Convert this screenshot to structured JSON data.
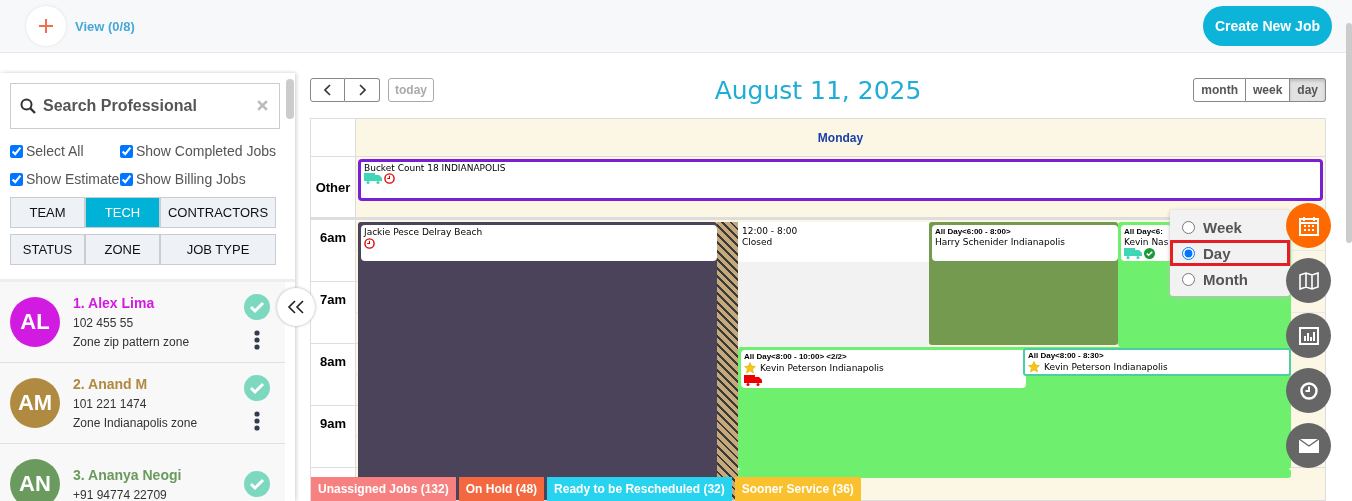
{
  "header": {
    "view_label": "View (0/8)",
    "create_button": "Create New Job"
  },
  "sidebar": {
    "search": {
      "placeholder": "Search Professional"
    },
    "options": [
      {
        "label": "Select All",
        "checked": true
      },
      {
        "label": "Show Completed Jobs",
        "checked": true
      },
      {
        "label": "Show Estimate",
        "checked": true
      },
      {
        "label": "Show Billing Jobs",
        "checked": true
      }
    ],
    "filter_tabs": [
      {
        "label": "TEAM",
        "selected": false
      },
      {
        "label": "TECH",
        "selected": true
      },
      {
        "label": "CONTRACTORS",
        "selected": false
      },
      {
        "label": "STATUS",
        "selected": false
      },
      {
        "label": "ZONE",
        "selected": false
      },
      {
        "label": "JOB TYPE",
        "selected": false
      }
    ],
    "technicians": [
      {
        "initials": "AL",
        "name": "1. Alex Lima",
        "phone": "102 455 55",
        "zone": "Zone zip pattern zone",
        "color": "#d21be0"
      },
      {
        "initials": "AM",
        "name": "2. Anand M",
        "phone": "101 221 1474",
        "zone": "Zone Indianapolis zone",
        "color": "#b08a40"
      },
      {
        "initials": "AN",
        "name": "3. Ananya Neogi",
        "phone": "+91 94774 22709",
        "color": "#6a9a5e"
      }
    ]
  },
  "calendar": {
    "today_button": "today",
    "title": "August 11, 2025",
    "views": [
      {
        "label": "month",
        "selected": false
      },
      {
        "label": "week",
        "selected": false
      },
      {
        "label": "day",
        "selected": true
      }
    ],
    "day_header": "Monday",
    "other_label": "Other",
    "other_event": {
      "title": "Bucket Count 18 INDIANAPOLIS",
      "color": "#7b1fd6"
    },
    "hours": [
      "6am",
      "7am",
      "8am",
      "9am"
    ],
    "events": [
      {
        "kind": "job",
        "title": "Jackie Pesce Delray Beach",
        "color": "#4a4359"
      },
      {
        "kind": "unavailable"
      },
      {
        "kind": "closed",
        "time": "12:00 - 8:00",
        "title": "Closed"
      },
      {
        "kind": "job",
        "time": "All Day<6:00 - 8:00>",
        "title": "Harry Schenider Indianapolis",
        "color": "#739a4e"
      },
      {
        "kind": "job",
        "time": "All Day<6:",
        "title": "Kevin Nas",
        "color": "#6ef06e"
      },
      {
        "kind": "job",
        "time": "All Day<8:00 - 10:00> <2/2>",
        "title": "Kevin Peterson Indianapolis",
        "color": "#6ef06e"
      },
      {
        "kind": "job",
        "time": "All Day<8:00 - 8:30>",
        "title": "Kevin Peterson Indianapolis",
        "color": "#4ccfa0"
      },
      {
        "kind": "job",
        "color": "#6ef06e"
      }
    ]
  },
  "view_menu": [
    {
      "label": "Week",
      "selected": false
    },
    {
      "label": "Day",
      "selected": true
    },
    {
      "label": "Month",
      "selected": false
    }
  ],
  "legend": [
    {
      "label": "Unassigned Jobs (132)",
      "color": "#f78181"
    },
    {
      "label": "On Hold (48)",
      "color": "#f4683f"
    },
    {
      "label": "Ready to be Rescheduled (32)",
      "color": "#27d3ee"
    },
    {
      "label": "Sooner Service (36)",
      "color": "#fbc02d"
    }
  ]
}
